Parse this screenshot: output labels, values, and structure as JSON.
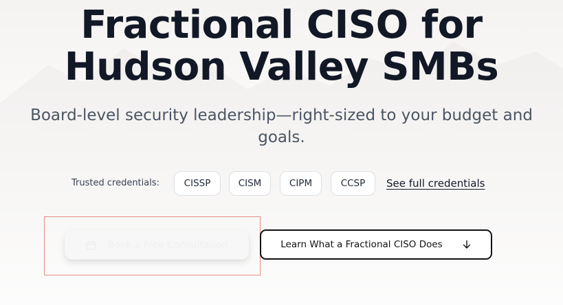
{
  "hero": {
    "title_line1": "Fractional CISO for",
    "title_line2": "Hudson Valley SMBs",
    "subtitle_line1": "Board-level security leadership—right-sized to your budget and",
    "subtitle_line2": "goals."
  },
  "credentials": {
    "label": "Trusted credentials:",
    "chips": [
      "CISSP",
      "CISM",
      "CIPM",
      "CCSP"
    ],
    "link_label": "See full credentials"
  },
  "cta": {
    "primary_label": "Book a Free Consultation",
    "primary_icon": "calendar-icon",
    "secondary_label": "Learn What a Fractional CISO Does",
    "secondary_icon": "arrow-down-icon"
  },
  "colors": {
    "heading": "#121826",
    "subtitle": "#4b5563",
    "highlight_border": "#e28b85"
  }
}
